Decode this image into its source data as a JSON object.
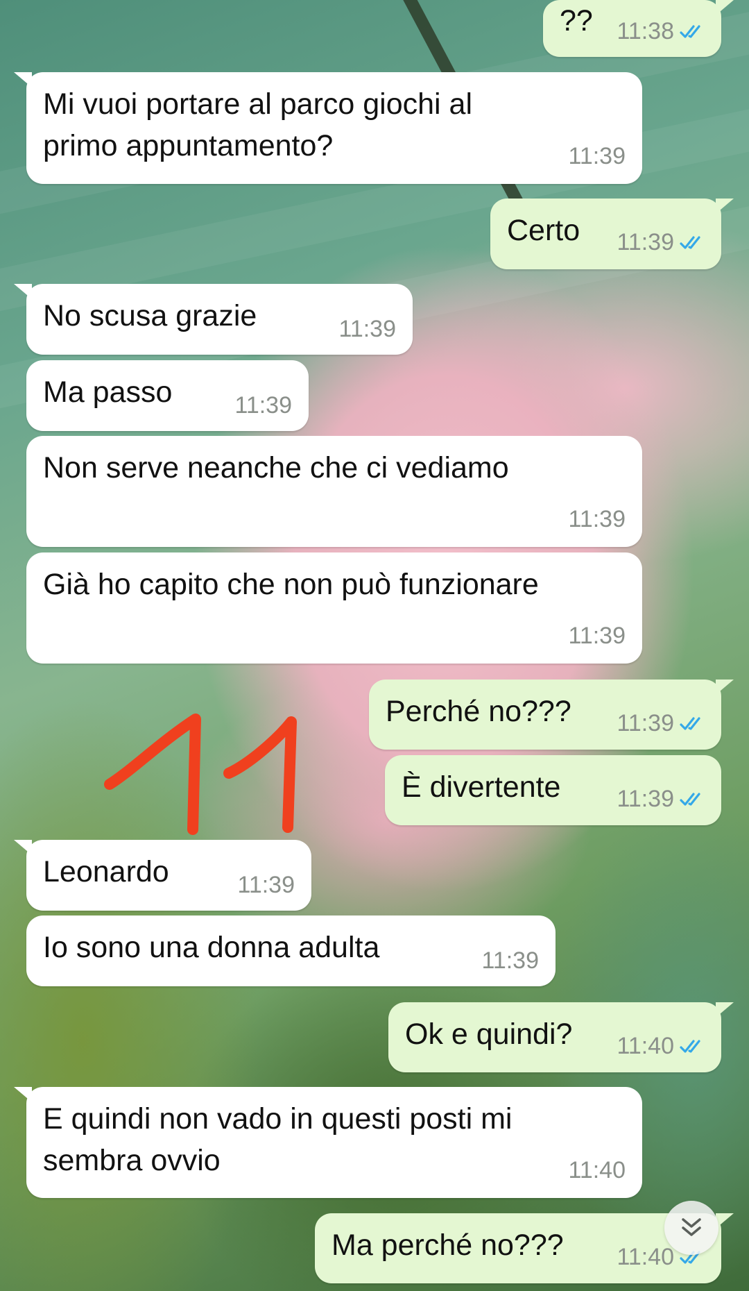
{
  "chat": {
    "messages": [
      {
        "direction": "out",
        "text": "??",
        "time": "11:38",
        "read": true
      },
      {
        "direction": "in",
        "text": "Mi vuoi portare al parco giochi al\nprimo appuntamento?",
        "time": "11:39"
      },
      {
        "direction": "out",
        "text": "Certo",
        "time": "11:39",
        "read": true
      },
      {
        "direction": "in",
        "text": "No scusa grazie",
        "time": "11:39"
      },
      {
        "direction": "in",
        "text": "Ma passo",
        "time": "11:39"
      },
      {
        "direction": "in",
        "text": "Non serve neanche che ci vediamo",
        "time": "11:39"
      },
      {
        "direction": "in",
        "text": "Già ho capito che non può funzionare",
        "time": "11:39"
      },
      {
        "direction": "out",
        "text": "Perché no???",
        "time": "11:39",
        "read": true
      },
      {
        "direction": "out",
        "text": "È divertente",
        "time": "11:39",
        "read": true
      },
      {
        "direction": "in",
        "text": "Leonardo",
        "time": "11:39"
      },
      {
        "direction": "in",
        "text": "Io sono una donna adulta",
        "time": "11:39"
      },
      {
        "direction": "out",
        "text": "Ok e quindi?",
        "time": "11:40",
        "read": true
      },
      {
        "direction": "in",
        "text": "E quindi non vado in questi posti mi\nsembra ovvio",
        "time": "11:40"
      },
      {
        "direction": "out",
        "text": "Ma perché no???",
        "time": "11:40",
        "read": true
      }
    ]
  },
  "annotation": {
    "text": "11",
    "color": "#f0401e"
  },
  "icons": {
    "read_receipt": "double-check-icon",
    "scroll_down": "chevron-double-down-icon"
  },
  "colors": {
    "incoming_bubble": "#ffffff",
    "outgoing_bubble": "#e4f7d2",
    "read_tick": "#34a8e8",
    "timestamp": "#8a8f8a"
  }
}
